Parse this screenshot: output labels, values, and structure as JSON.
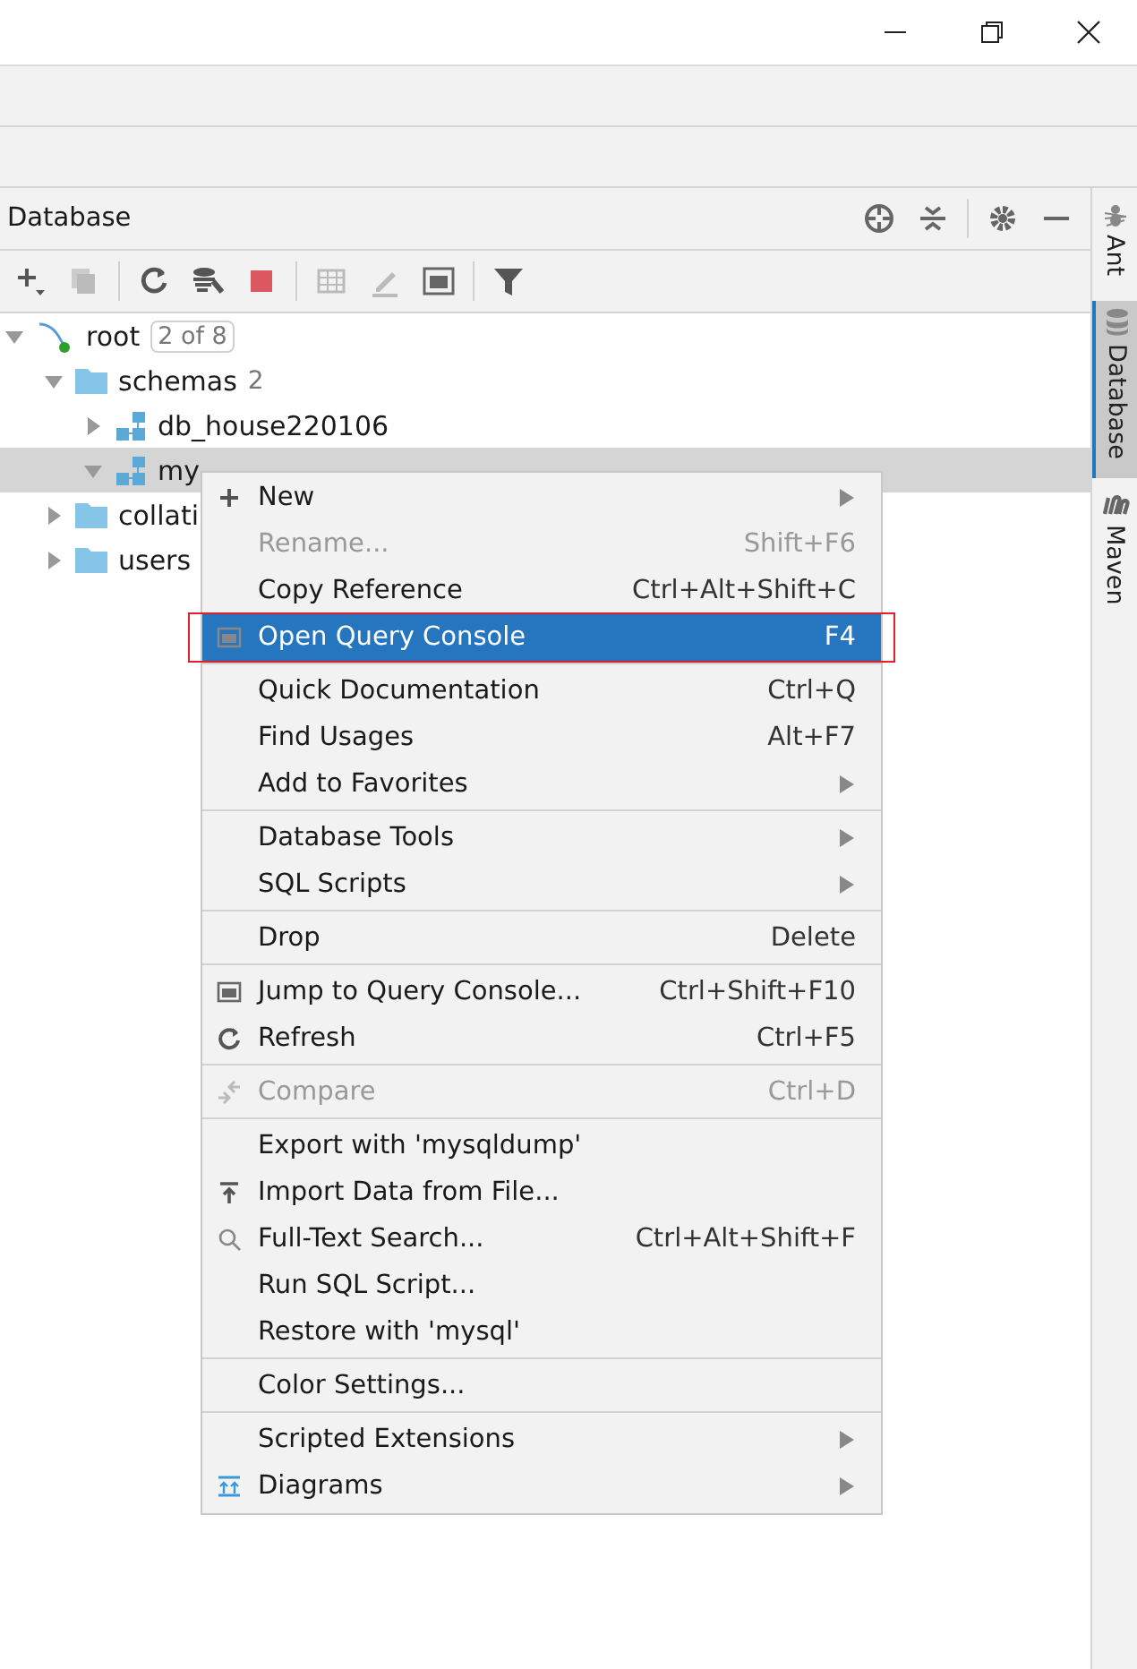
{
  "panel": {
    "title": "Database"
  },
  "side_tabs": [
    {
      "label": "Ant",
      "selected": false
    },
    {
      "label": "Database",
      "selected": true
    },
    {
      "label": "Maven",
      "selected": false
    }
  ],
  "tree": [
    {
      "label": "root",
      "badge": "2 of 8",
      "expanded": true,
      "selected": false,
      "children": [
        {
          "label": "schemas",
          "count": "2",
          "expanded": true,
          "selected": false,
          "children": [
            {
              "label": "db_house220106",
              "expanded": false,
              "selected": false
            },
            {
              "label": "my",
              "expanded": true,
              "selected": true
            }
          ]
        },
        {
          "label": "collati",
          "expanded": false,
          "selected": false
        },
        {
          "label": "users",
          "expanded": false,
          "selected": false
        }
      ]
    }
  ],
  "context_menu": {
    "groups": [
      [
        {
          "label": "New",
          "submenu": true,
          "disabled": false,
          "selected": false
        },
        {
          "label": "Rename...",
          "shortcut": "Shift+F6",
          "submenu": false,
          "disabled": true,
          "selected": false
        },
        {
          "label": "Copy Reference",
          "shortcut": "Ctrl+Alt+Shift+C",
          "submenu": false,
          "disabled": false,
          "selected": false
        },
        {
          "label": "Open Query Console",
          "shortcut": "F4",
          "submenu": false,
          "disabled": false,
          "selected": true
        }
      ],
      [
        {
          "label": "Quick Documentation",
          "shortcut": "Ctrl+Q",
          "submenu": false,
          "disabled": false,
          "selected": false
        },
        {
          "label": "Find Usages",
          "shortcut": "Alt+F7",
          "submenu": false,
          "disabled": false,
          "selected": false
        },
        {
          "label": "Add to Favorites",
          "submenu": true,
          "disabled": false,
          "selected": false
        }
      ],
      [
        {
          "label": "Database Tools",
          "submenu": true,
          "disabled": false,
          "selected": false
        },
        {
          "label": "SQL Scripts",
          "submenu": true,
          "disabled": false,
          "selected": false
        }
      ],
      [
        {
          "label": "Drop",
          "shortcut": "Delete",
          "submenu": false,
          "disabled": false,
          "selected": false
        }
      ],
      [
        {
          "label": "Jump to Query Console...",
          "shortcut": "Ctrl+Shift+F10",
          "submenu": false,
          "disabled": false,
          "selected": false
        },
        {
          "label": "Refresh",
          "shortcut": "Ctrl+F5",
          "submenu": false,
          "disabled": false,
          "selected": false
        }
      ],
      [
        {
          "label": "Compare",
          "shortcut": "Ctrl+D",
          "submenu": false,
          "disabled": true,
          "selected": false
        }
      ],
      [
        {
          "label": "Export with 'mysqldump'",
          "submenu": false,
          "disabled": false,
          "selected": false
        },
        {
          "label": "Import Data from File...",
          "submenu": false,
          "disabled": false,
          "selected": false
        },
        {
          "label": "Full-Text Search...",
          "shortcut": "Ctrl+Alt+Shift+F",
          "submenu": false,
          "disabled": false,
          "selected": false
        },
        {
          "label": "Run SQL Script...",
          "submenu": false,
          "disabled": false,
          "selected": false
        },
        {
          "label": "Restore with 'mysql'",
          "submenu": false,
          "disabled": false,
          "selected": false
        }
      ],
      [
        {
          "label": "Color Settings...",
          "submenu": false,
          "disabled": false,
          "selected": false
        }
      ],
      [
        {
          "label": "Scripted Extensions",
          "submenu": true,
          "disabled": false,
          "selected": false
        },
        {
          "label": "Diagrams",
          "submenu": true,
          "disabled": false,
          "selected": false
        }
      ]
    ]
  }
}
